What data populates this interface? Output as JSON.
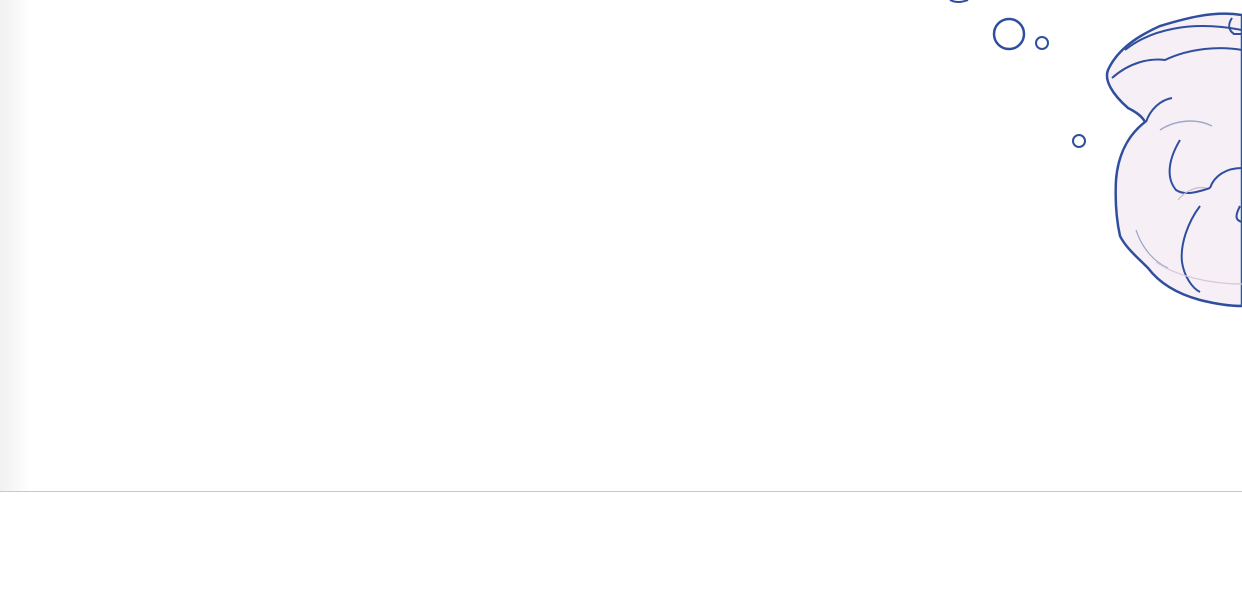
{
  "image": {
    "description_colors": {
      "background": "#ffffff",
      "line_art": "#2f4f9e",
      "fill": "#f6eef6",
      "divider": "#c9c9c9"
    },
    "icons": [
      "bubble-icon",
      "cloud-sketch"
    ]
  }
}
